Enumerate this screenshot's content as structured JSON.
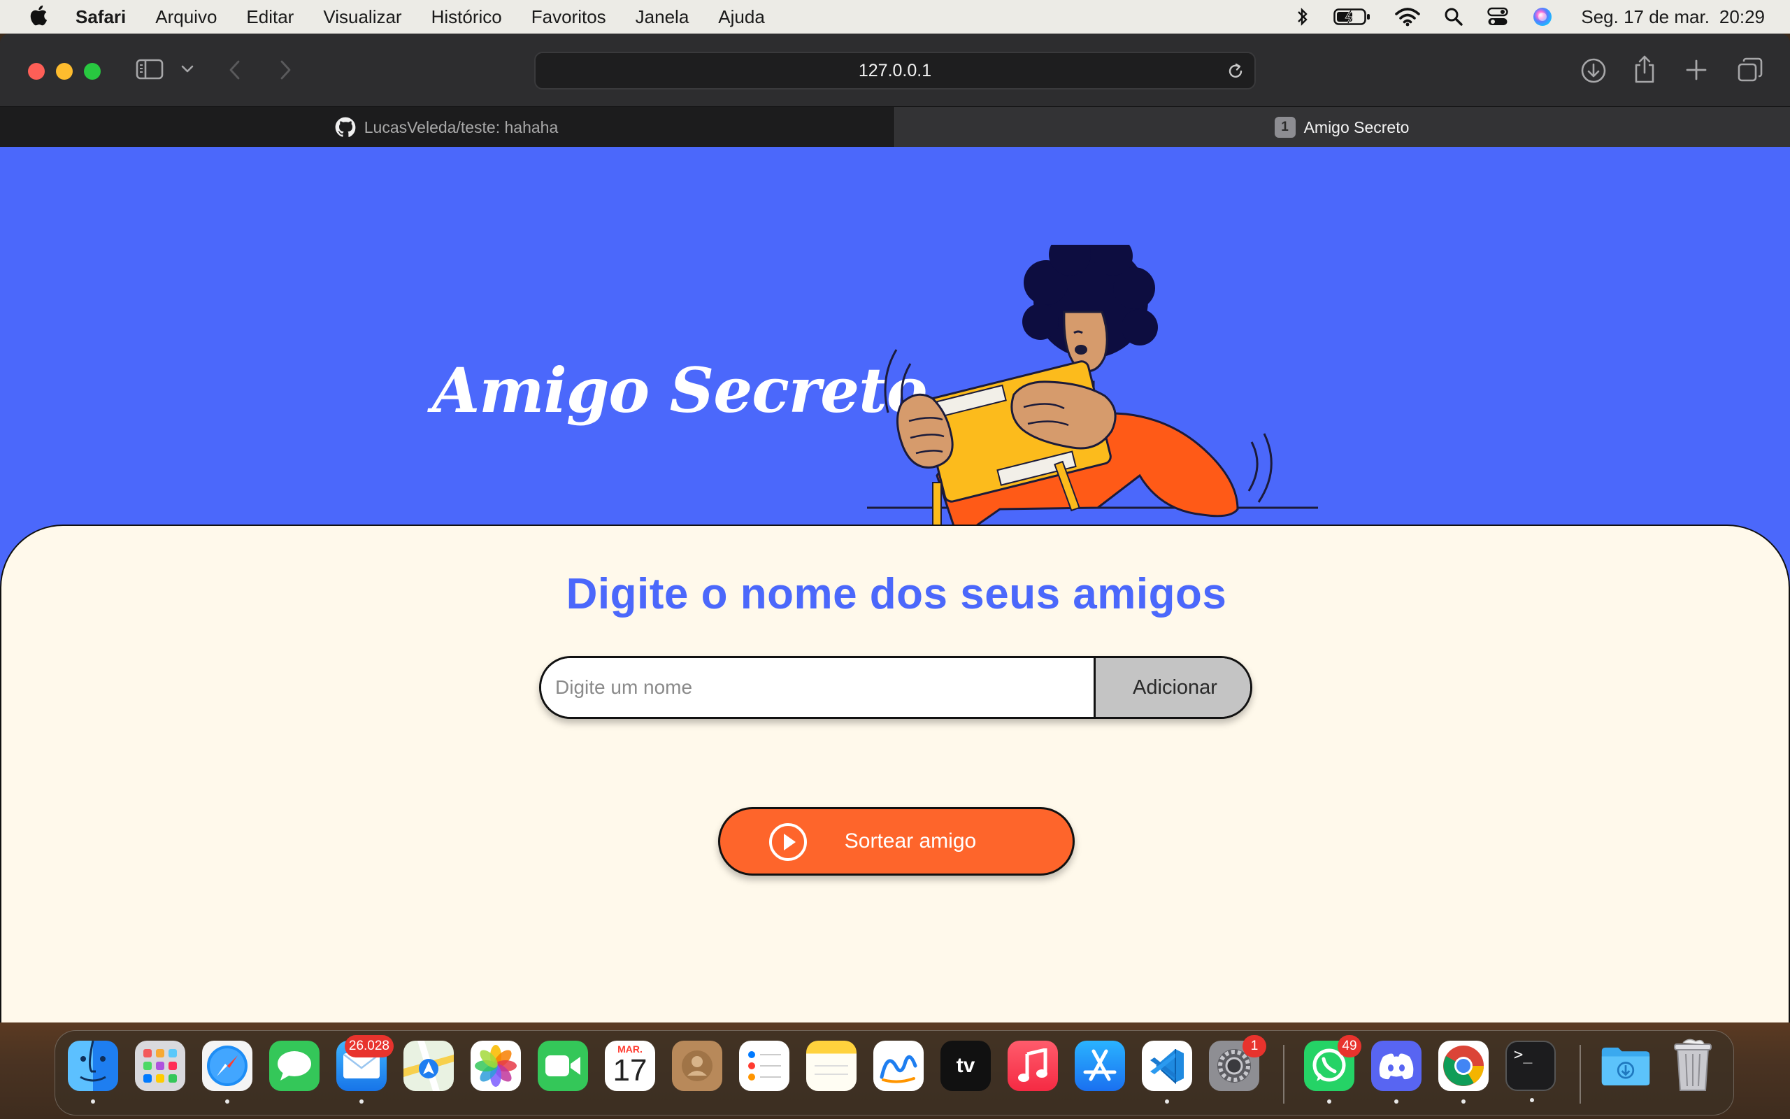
{
  "menubar": {
    "app_name": "Safari",
    "items": [
      "Arquivo",
      "Editar",
      "Visualizar",
      "Histórico",
      "Favoritos",
      "Janela",
      "Ajuda"
    ],
    "date": "Seg. 17 de mar.",
    "time": "20:29"
  },
  "browser": {
    "url": "127.0.0.1",
    "tabs": [
      {
        "label": "LucasVeleda/teste: hahaha",
        "icon": "github-icon",
        "active": false
      },
      {
        "label": "Amigo Secreto",
        "badge": "1",
        "active": true
      }
    ]
  },
  "page": {
    "hero_title": "Amigo Secreto",
    "heading": "Digite o nome dos seus amigos",
    "name_input": {
      "placeholder": "Digite um nome",
      "value": ""
    },
    "add_label": "Adicionar",
    "draw_label": "Sortear amigo",
    "colors": {
      "primary_blue": "#4b68fb",
      "accent_orange": "#fe652b",
      "card_bg": "#fff9eb",
      "button_gray": "#c4c4c4"
    }
  },
  "dock": {
    "apps": [
      {
        "name": "finder-icon"
      },
      {
        "name": "launchpad-icon"
      },
      {
        "name": "safari-icon"
      },
      {
        "name": "messages-icon"
      },
      {
        "name": "mail-icon",
        "badge": "26.028"
      },
      {
        "name": "maps-icon"
      },
      {
        "name": "photos-icon"
      },
      {
        "name": "facetime-icon"
      },
      {
        "name": "calendar-icon",
        "month": "MAR.",
        "day": "17"
      },
      {
        "name": "contacts-icon"
      },
      {
        "name": "reminders-icon"
      },
      {
        "name": "notes-icon"
      },
      {
        "name": "freeform-icon"
      },
      {
        "name": "apple-tv-icon",
        "label": "tv"
      },
      {
        "name": "music-icon"
      },
      {
        "name": "app-store-icon"
      },
      {
        "name": "vscode-icon"
      },
      {
        "name": "system-settings-icon",
        "badge": "1"
      },
      {
        "name": "whatsapp-icon",
        "badge": "49"
      },
      {
        "name": "discord-icon"
      },
      {
        "name": "chrome-icon"
      },
      {
        "name": "terminal-icon",
        "label": ">_"
      },
      {
        "name": "downloads-folder-icon"
      },
      {
        "name": "trash-icon"
      }
    ]
  }
}
